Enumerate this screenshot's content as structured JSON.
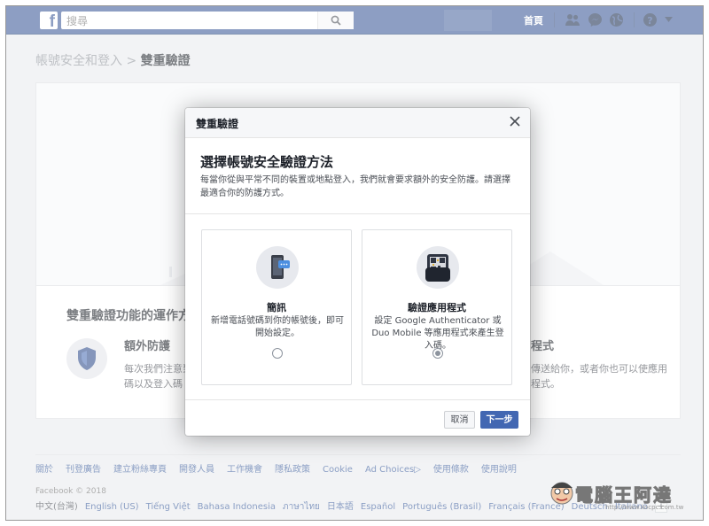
{
  "topbar": {
    "logo": "f",
    "search_placeholder": "搜尋",
    "home": "首頁",
    "icons": [
      "friends-icon",
      "messenger-icon",
      "globe-icon",
      "help-icon",
      "caret-icon"
    ]
  },
  "page": {
    "breadcrumb_parent": "帳號安全和登入",
    "breadcrumb_sep": ">",
    "breadcrumb_current": "雙重驗證",
    "feature_title": "雙重驗證功能的運作方",
    "feature1_heading": "額外防護",
    "feature1_text": "每次我們注意到碼以及登入碼",
    "feature2_heading": "程式",
    "feature2_text": "傳送給你，或者你也可以使應用程式。"
  },
  "modal": {
    "title": "雙重驗證",
    "heading": "選擇帳號安全驗證方法",
    "description": "每當你從與平常不同的裝置或地點登入，我們就會要求額外的安全防護。請選擇最適合你的防護方式。",
    "options": [
      {
        "title": "簡訊",
        "text": "新增電話號碼到你的帳號後，即可開始設定。",
        "selected": false
      },
      {
        "title": "驗證應用程式",
        "text": "設定 Google Authenticator 或 Duo Mobile 等應用程式來產生登入碼。",
        "selected": true
      }
    ],
    "cancel": "取消",
    "next": "下一步"
  },
  "footer": {
    "links": [
      "關於",
      "刊登廣告",
      "建立粉絲專頁",
      "開發人員",
      "工作機會",
      "隱私政策",
      "Cookie",
      "Ad Choices▷",
      "使用條款",
      "使用說明"
    ],
    "copyright": "Facebook © 2018",
    "languages": [
      "中文(台灣)",
      "English (US)",
      "Tiếng Việt",
      "Bahasa Indonesia",
      "ภาษาไทย",
      "日本語",
      "Español",
      "Português (Brasil)",
      "Français (France)",
      "Deutsch",
      "Italiano"
    ],
    "plus": "+"
  },
  "watermark": {
    "text": "電腦王阿達",
    "url": "http://www.kocpc.com.tw"
  },
  "colors": {
    "brand": "#3b5998",
    "button_primary": "#4267b2",
    "link": "#365899"
  }
}
